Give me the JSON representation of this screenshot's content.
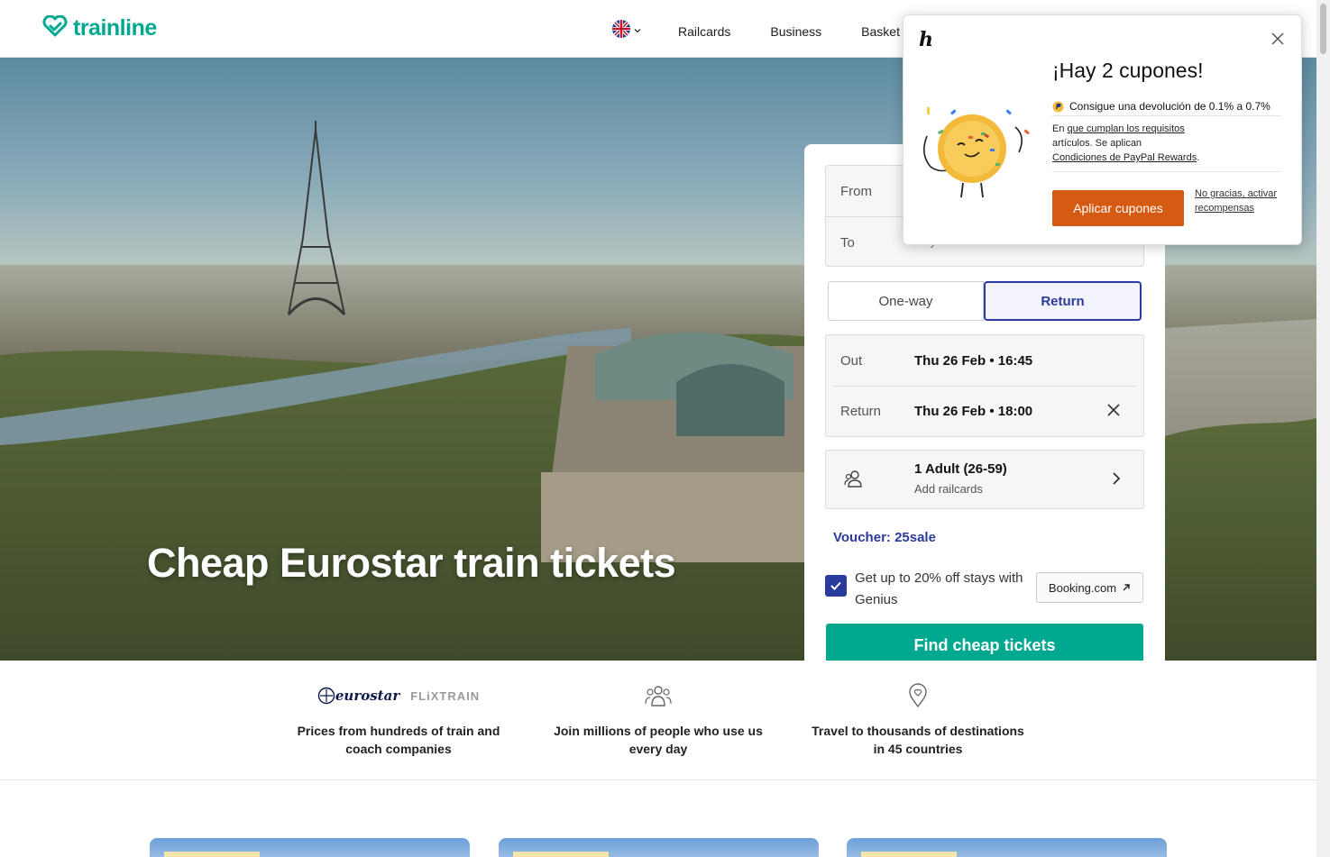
{
  "header": {
    "logo": "trainline",
    "nav": [
      "Railcards",
      "Business",
      "Basket"
    ],
    "flag_icon": "uk-flag-icon"
  },
  "hero": {
    "title": "Cheap Eurostar train tickets"
  },
  "search": {
    "from_label": "From",
    "to_label": "To",
    "to_placeholder": "City or station",
    "one_way": "One-way",
    "return": "Return",
    "out_label": "Out",
    "out_value": "Thu 26 Feb • 16:45",
    "return_label": "Return",
    "return_value": "Thu 26 Feb • 18:00",
    "passengers": "1 Adult (26-59)",
    "railcards": "Add railcards",
    "voucher": "Voucher: 25sale",
    "genius_text": "Get up to 20% off stays with Genius",
    "booking_label": "Booking.com",
    "find_button": "Find cheap tickets"
  },
  "features": [
    {
      "brand1": "eurostar",
      "brand2": "FLiXTRAIN",
      "text": "Prices from hundreds of train and coach companies"
    },
    {
      "text": "Join millions of people who use us every day"
    },
    {
      "text": "Travel to thousands of destinations in 45 countries"
    }
  ],
  "popup": {
    "brand": "h",
    "title": "¡Hay 2 cupones!",
    "cashback": "Consigue una devolución de 0.1% a 0.7%",
    "note_prefix": "En ",
    "note_link1": "que cumplan los requisitos",
    "note_mid": " artículos. Se aplican ",
    "note_link2": "Condiciones de PayPal Rewards",
    "note_suffix": ".",
    "apply": "Aplicar cupones",
    "no_thanks": "No gracias, activar recompensas"
  },
  "colors": {
    "brand_green": "#00a88f",
    "accent_blue": "#2b3a9d",
    "coupon_orange": "#d55b12"
  }
}
